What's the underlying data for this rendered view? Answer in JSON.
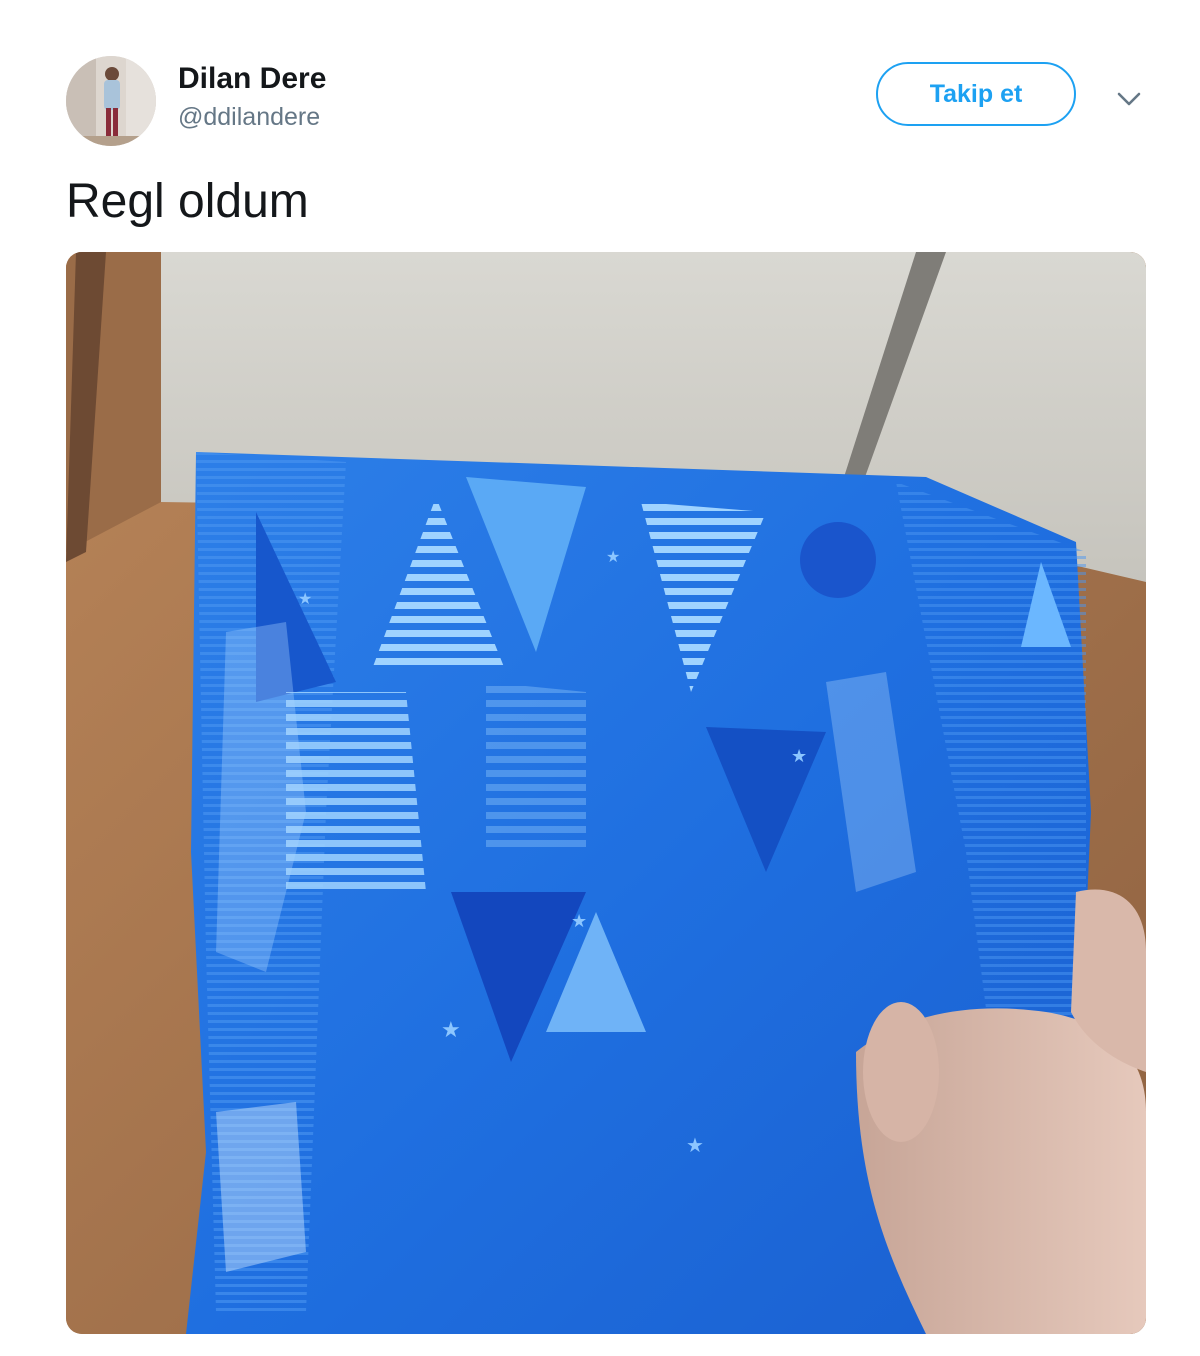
{
  "tweet": {
    "author_name": "Dilan Dere",
    "author_handle": "@ddilandere",
    "follow_label": "Takip et",
    "text": "Regl oldum",
    "avatar_icon": "user-avatar",
    "menu_icon": "chevron-down-icon",
    "media_icon": "tweet-photo"
  },
  "colors": {
    "accent": "#1da1f2",
    "name": "#14171a",
    "handle": "#657786"
  }
}
